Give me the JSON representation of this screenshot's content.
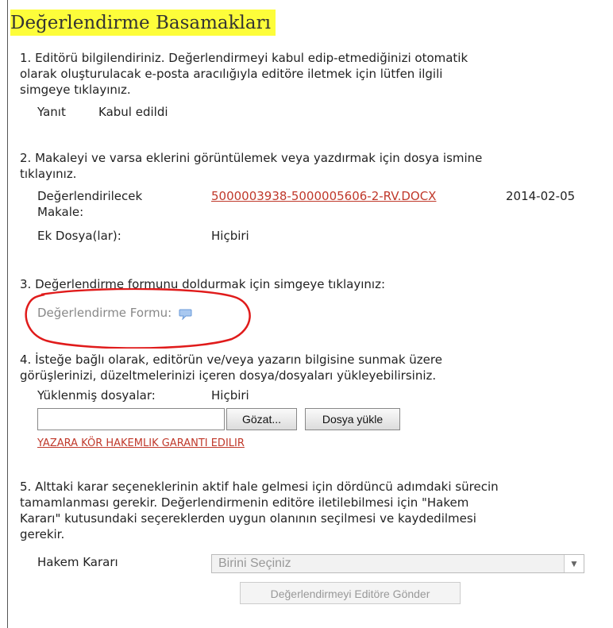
{
  "title": "Değerlendirme Basamakları",
  "step1": {
    "text": "1. Editörü bilgilendiriniz. Değerlendirmeyi kabul edip-etmediğinizi otomatik\n   olarak oluşturulacak e-posta aracılığıyla editöre iletmek için lütfen ilgili\n   simgeye tıklayınız.",
    "response_label": "Yanıt",
    "response_value": "Kabul edildi"
  },
  "step2": {
    "text": "2. Makaleyi ve varsa eklerini görüntülemek veya yazdırmak için dosya ismine\n   tıklayınız.",
    "file_label": "Değerlendirilecek\nMakale:",
    "file_link": "5000003938-5000005606-2-RV.DOCX",
    "file_date": "2014-02-05",
    "attachments_label": "Ek Dosya(lar):",
    "attachments_value": "Hiçbiri"
  },
  "step3": {
    "text": "3. Değerlendirme formunu doldurmak için simgeye tıklayınız:",
    "form_label": "Değerlendirme Formu:"
  },
  "step4": {
    "text": "4. İsteğe bağlı olarak, editörün ve/veya yazarın bilgisine sunmak üzere\n   görüşlerinizi, düzeltmelerinizi içeren dosya/dosyaları yükleyebilirsiniz.",
    "uploaded_label": "Yüklenmiş dosyalar:",
    "uploaded_value": "Hiçbiri",
    "browse_button": "Gözat...",
    "upload_button": "Dosya yükle",
    "blind_link": "YAZARA KÖR HAKEMLIK GARANTI EDILIR"
  },
  "step5": {
    "text": "5. Alttaki karar seçeneklerinin aktif hale gelmesi için dördüncü adımdaki sürecin\n   tamamlanması gerekir. Değerlendirmenin editöre iletilebilmesi için \"Hakem\n   Kararı\" kutusundaki seçereklerden uygun olanının seçilmesi ve kaydedilmesi\n   gerekir.",
    "decision_label": "Hakem Kararı",
    "decision_selected": "Birini Seçiniz",
    "send_button": "Değerlendirmeyi Editöre Gönder"
  },
  "colors": {
    "highlight": "#fdfd3a",
    "link": "#c0392b",
    "annotation": "#e01b1b",
    "icon": "#6a9ad8"
  },
  "icons": {
    "form_icon": "speech-bubble-icon",
    "select_arrow": "chevron-down-icon"
  }
}
